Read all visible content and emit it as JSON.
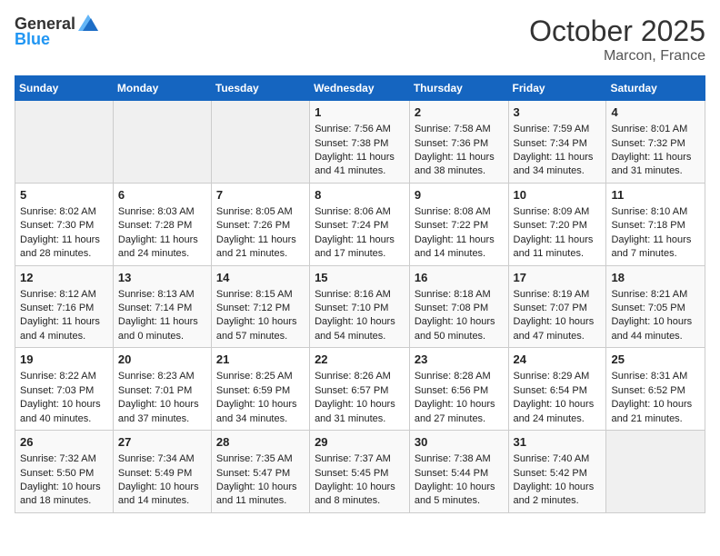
{
  "header": {
    "logo": {
      "general": "General",
      "blue": "Blue"
    },
    "month": "October 2025",
    "location": "Marcon, France"
  },
  "weekdays": [
    "Sunday",
    "Monday",
    "Tuesday",
    "Wednesday",
    "Thursday",
    "Friday",
    "Saturday"
  ],
  "weeks": [
    [
      {
        "day": "",
        "sunrise": "",
        "sunset": "",
        "daylight": ""
      },
      {
        "day": "",
        "sunrise": "",
        "sunset": "",
        "daylight": ""
      },
      {
        "day": "",
        "sunrise": "",
        "sunset": "",
        "daylight": ""
      },
      {
        "day": "1",
        "sunrise": "Sunrise: 7:56 AM",
        "sunset": "Sunset: 7:38 PM",
        "daylight": "Daylight: 11 hours and 41 minutes."
      },
      {
        "day": "2",
        "sunrise": "Sunrise: 7:58 AM",
        "sunset": "Sunset: 7:36 PM",
        "daylight": "Daylight: 11 hours and 38 minutes."
      },
      {
        "day": "3",
        "sunrise": "Sunrise: 7:59 AM",
        "sunset": "Sunset: 7:34 PM",
        "daylight": "Daylight: 11 hours and 34 minutes."
      },
      {
        "day": "4",
        "sunrise": "Sunrise: 8:01 AM",
        "sunset": "Sunset: 7:32 PM",
        "daylight": "Daylight: 11 hours and 31 minutes."
      }
    ],
    [
      {
        "day": "5",
        "sunrise": "Sunrise: 8:02 AM",
        "sunset": "Sunset: 7:30 PM",
        "daylight": "Daylight: 11 hours and 28 minutes."
      },
      {
        "day": "6",
        "sunrise": "Sunrise: 8:03 AM",
        "sunset": "Sunset: 7:28 PM",
        "daylight": "Daylight: 11 hours and 24 minutes."
      },
      {
        "day": "7",
        "sunrise": "Sunrise: 8:05 AM",
        "sunset": "Sunset: 7:26 PM",
        "daylight": "Daylight: 11 hours and 21 minutes."
      },
      {
        "day": "8",
        "sunrise": "Sunrise: 8:06 AM",
        "sunset": "Sunset: 7:24 PM",
        "daylight": "Daylight: 11 hours and 17 minutes."
      },
      {
        "day": "9",
        "sunrise": "Sunrise: 8:08 AM",
        "sunset": "Sunset: 7:22 PM",
        "daylight": "Daylight: 11 hours and 14 minutes."
      },
      {
        "day": "10",
        "sunrise": "Sunrise: 8:09 AM",
        "sunset": "Sunset: 7:20 PM",
        "daylight": "Daylight: 11 hours and 11 minutes."
      },
      {
        "day": "11",
        "sunrise": "Sunrise: 8:10 AM",
        "sunset": "Sunset: 7:18 PM",
        "daylight": "Daylight: 11 hours and 7 minutes."
      }
    ],
    [
      {
        "day": "12",
        "sunrise": "Sunrise: 8:12 AM",
        "sunset": "Sunset: 7:16 PM",
        "daylight": "Daylight: 11 hours and 4 minutes."
      },
      {
        "day": "13",
        "sunrise": "Sunrise: 8:13 AM",
        "sunset": "Sunset: 7:14 PM",
        "daylight": "Daylight: 11 hours and 0 minutes."
      },
      {
        "day": "14",
        "sunrise": "Sunrise: 8:15 AM",
        "sunset": "Sunset: 7:12 PM",
        "daylight": "Daylight: 10 hours and 57 minutes."
      },
      {
        "day": "15",
        "sunrise": "Sunrise: 8:16 AM",
        "sunset": "Sunset: 7:10 PM",
        "daylight": "Daylight: 10 hours and 54 minutes."
      },
      {
        "day": "16",
        "sunrise": "Sunrise: 8:18 AM",
        "sunset": "Sunset: 7:08 PM",
        "daylight": "Daylight: 10 hours and 50 minutes."
      },
      {
        "day": "17",
        "sunrise": "Sunrise: 8:19 AM",
        "sunset": "Sunset: 7:07 PM",
        "daylight": "Daylight: 10 hours and 47 minutes."
      },
      {
        "day": "18",
        "sunrise": "Sunrise: 8:21 AM",
        "sunset": "Sunset: 7:05 PM",
        "daylight": "Daylight: 10 hours and 44 minutes."
      }
    ],
    [
      {
        "day": "19",
        "sunrise": "Sunrise: 8:22 AM",
        "sunset": "Sunset: 7:03 PM",
        "daylight": "Daylight: 10 hours and 40 minutes."
      },
      {
        "day": "20",
        "sunrise": "Sunrise: 8:23 AM",
        "sunset": "Sunset: 7:01 PM",
        "daylight": "Daylight: 10 hours and 37 minutes."
      },
      {
        "day": "21",
        "sunrise": "Sunrise: 8:25 AM",
        "sunset": "Sunset: 6:59 PM",
        "daylight": "Daylight: 10 hours and 34 minutes."
      },
      {
        "day": "22",
        "sunrise": "Sunrise: 8:26 AM",
        "sunset": "Sunset: 6:57 PM",
        "daylight": "Daylight: 10 hours and 31 minutes."
      },
      {
        "day": "23",
        "sunrise": "Sunrise: 8:28 AM",
        "sunset": "Sunset: 6:56 PM",
        "daylight": "Daylight: 10 hours and 27 minutes."
      },
      {
        "day": "24",
        "sunrise": "Sunrise: 8:29 AM",
        "sunset": "Sunset: 6:54 PM",
        "daylight": "Daylight: 10 hours and 24 minutes."
      },
      {
        "day": "25",
        "sunrise": "Sunrise: 8:31 AM",
        "sunset": "Sunset: 6:52 PM",
        "daylight": "Daylight: 10 hours and 21 minutes."
      }
    ],
    [
      {
        "day": "26",
        "sunrise": "Sunrise: 7:32 AM",
        "sunset": "Sunset: 5:50 PM",
        "daylight": "Daylight: 10 hours and 18 minutes."
      },
      {
        "day": "27",
        "sunrise": "Sunrise: 7:34 AM",
        "sunset": "Sunset: 5:49 PM",
        "daylight": "Daylight: 10 hours and 14 minutes."
      },
      {
        "day": "28",
        "sunrise": "Sunrise: 7:35 AM",
        "sunset": "Sunset: 5:47 PM",
        "daylight": "Daylight: 10 hours and 11 minutes."
      },
      {
        "day": "29",
        "sunrise": "Sunrise: 7:37 AM",
        "sunset": "Sunset: 5:45 PM",
        "daylight": "Daylight: 10 hours and 8 minutes."
      },
      {
        "day": "30",
        "sunrise": "Sunrise: 7:38 AM",
        "sunset": "Sunset: 5:44 PM",
        "daylight": "Daylight: 10 hours and 5 minutes."
      },
      {
        "day": "31",
        "sunrise": "Sunrise: 7:40 AM",
        "sunset": "Sunset: 5:42 PM",
        "daylight": "Daylight: 10 hours and 2 minutes."
      },
      {
        "day": "",
        "sunrise": "",
        "sunset": "",
        "daylight": ""
      }
    ]
  ]
}
